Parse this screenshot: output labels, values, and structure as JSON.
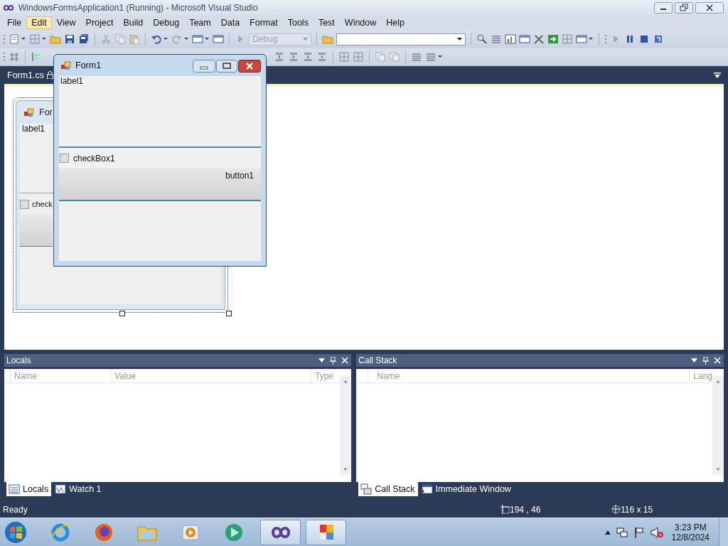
{
  "window": {
    "title": "WindowsFormsApplication1 (Running) - Microsoft Visual Studio"
  },
  "menu": [
    {
      "label": "File",
      "selected": false
    },
    {
      "label": "Edit",
      "selected": true
    },
    {
      "label": "View",
      "selected": false
    },
    {
      "label": "Project",
      "selected": false
    },
    {
      "label": "Build",
      "selected": false
    },
    {
      "label": "Debug",
      "selected": false
    },
    {
      "label": "Team",
      "selected": false
    },
    {
      "label": "Data",
      "selected": false
    },
    {
      "label": "Format",
      "selected": false
    },
    {
      "label": "Tools",
      "selected": false
    },
    {
      "label": "Test",
      "selected": false
    },
    {
      "label": "Window",
      "selected": false
    },
    {
      "label": "Help",
      "selected": false
    }
  ],
  "toolbar": {
    "configuration": {
      "value": "Debug",
      "disabled": true
    }
  },
  "document_tabs": [
    {
      "label": "Form1.cs",
      "selected": true
    }
  ],
  "designer_form": {
    "title": "For",
    "label": "label1",
    "checkbox": {
      "label": "check",
      "checked": false
    }
  },
  "running_form": {
    "title": "Form1",
    "label": "label1",
    "checkbox": {
      "label": "checkBox1",
      "checked": false
    },
    "button": "button1"
  },
  "panels": [
    {
      "title": "Locals",
      "columns": [
        "Name",
        "Value",
        "Type"
      ],
      "tabs": [
        {
          "label": "Locals",
          "kind": "locals",
          "selected": true
        },
        {
          "label": "Watch 1",
          "kind": "watch",
          "selected": false
        }
      ]
    },
    {
      "title": "Call Stack",
      "columns": [
        "Name",
        "Lang"
      ],
      "tabs": [
        {
          "label": "Call Stack",
          "kind": "callstack",
          "selected": true
        },
        {
          "label": "Immediate Window",
          "kind": "immediate",
          "selected": false
        }
      ]
    }
  ],
  "status_bar": {
    "text": "Ready",
    "position": "194 , 46",
    "size": "116 x 15"
  },
  "taskbar": {
    "apps": [
      {
        "kind": "ie",
        "active": false
      },
      {
        "kind": "firefox",
        "active": false
      },
      {
        "kind": "explorer",
        "active": false
      },
      {
        "kind": "media",
        "active": false
      },
      {
        "kind": "player",
        "active": false
      },
      {
        "kind": "vs",
        "active": true
      },
      {
        "kind": "tiles",
        "active": true
      }
    ],
    "clock": {
      "time": "3:23 PM",
      "date": "12/8/2024"
    }
  }
}
